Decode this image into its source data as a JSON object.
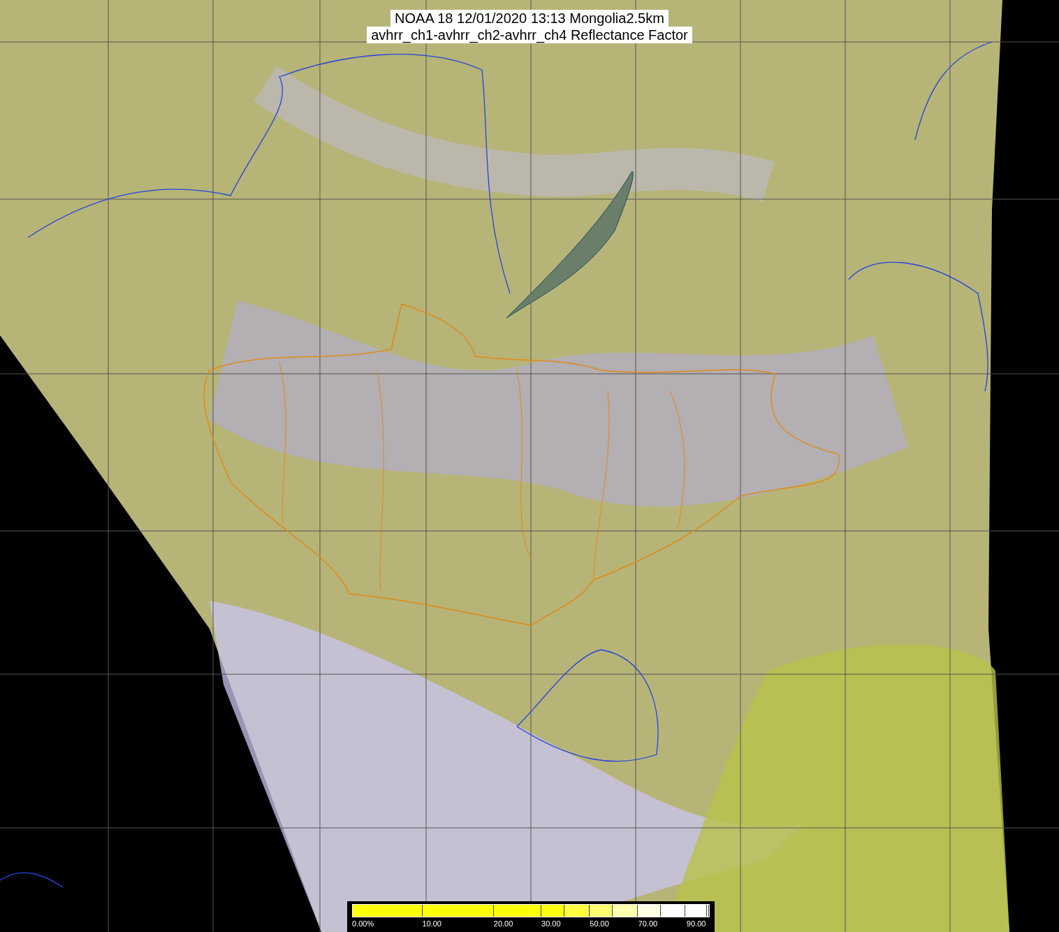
{
  "title": {
    "lines": [
      "NOAA 18 12/01/2020 13:13 Mongolia2.5km",
      "avhrr_ch1-avhrr_ch2-avhrr_ch4 Reflectance Factor"
    ]
  },
  "colorbar": {
    "segments": [
      {
        "color": "#ffff00"
      },
      {
        "color": "#ffff00"
      },
      {
        "color": "#ffff00"
      },
      {
        "color": "#ffff10"
      },
      {
        "color": "#ffff40"
      },
      {
        "color": "#ffff70"
      },
      {
        "color": "#ffffb0"
      },
      {
        "color": "#ffffe8"
      },
      {
        "color": "#ffffff"
      },
      {
        "color": "#ffffff"
      },
      {
        "color": "#ffffff"
      }
    ],
    "labels": [
      "0.00%",
      "10.00",
      "20.00",
      "30.00",
      "50.00",
      "70.00",
      "90.00"
    ]
  }
}
